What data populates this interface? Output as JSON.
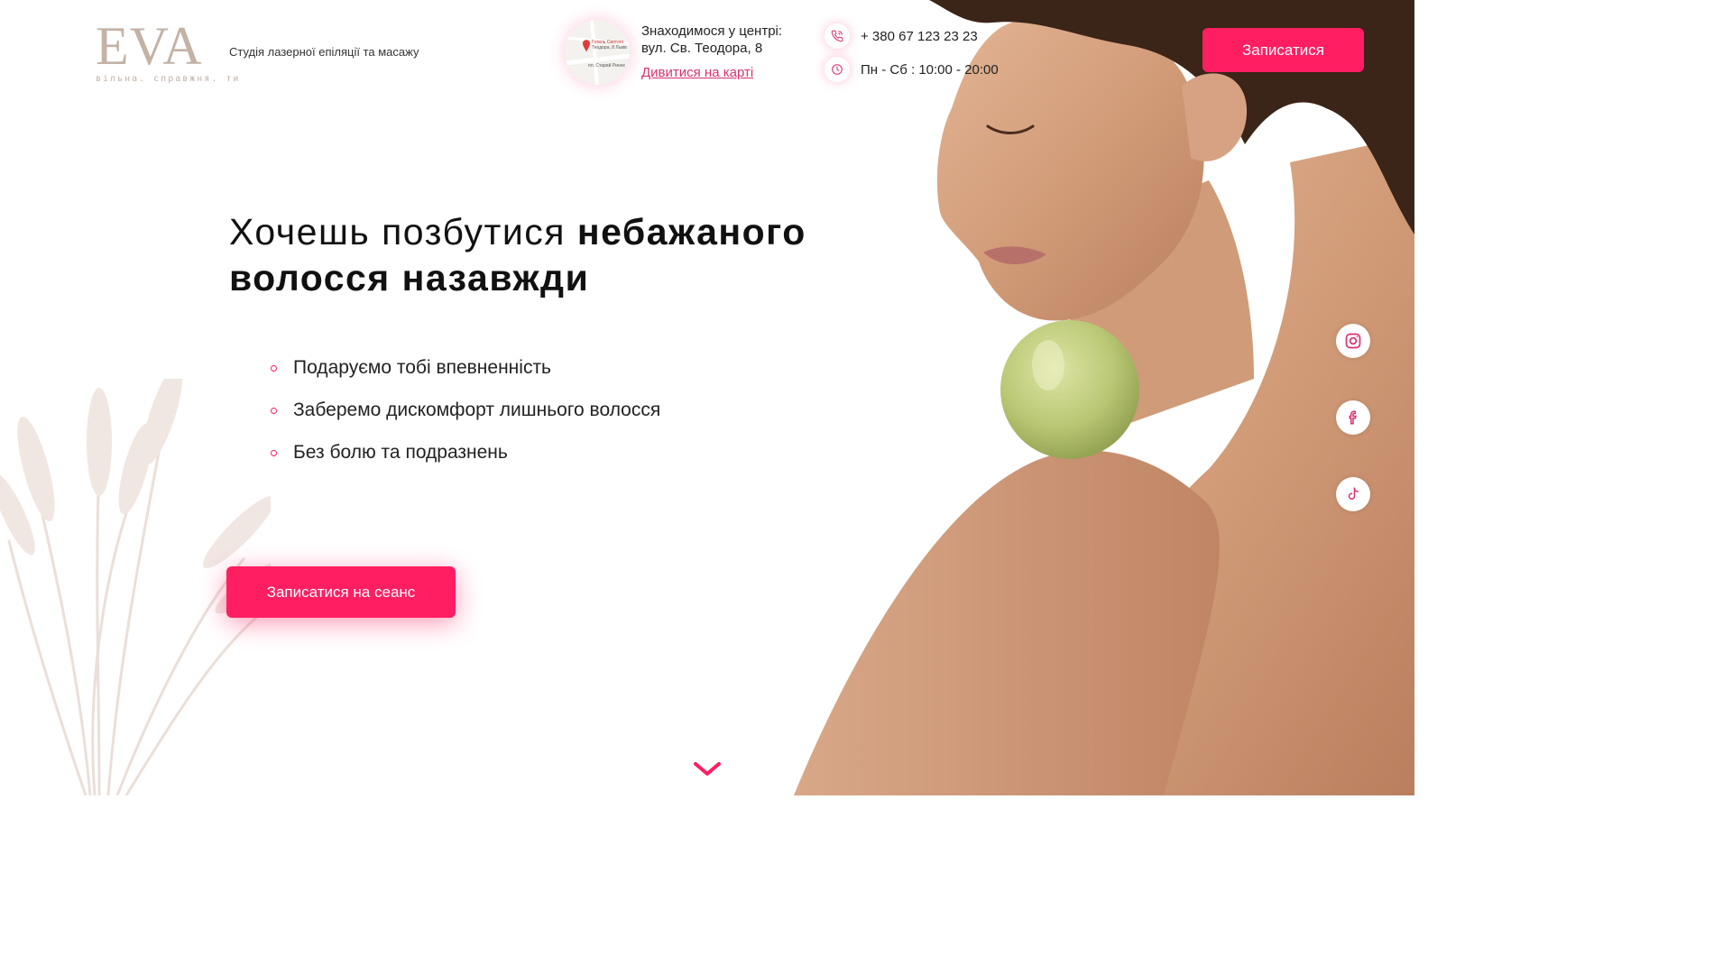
{
  "header": {
    "logo_text": "EVA",
    "logo_tagline": "вільна. справжня. ти",
    "studio_description": "Студія лазерної епіляції та масажу",
    "address_line1": "Знаходимося у центрі:",
    "address_line2": "вул. Св. Теодора, 8",
    "map_link": "Дивитися на карті",
    "phone": "+ 380 67 123 23 23",
    "hours": "Пн - Сб : 10:00 - 20:00",
    "book_button": "Записатися"
  },
  "map_thumbnail": {
    "labels": [
      "Готель Святого",
      "Теодора, 8 Львів",
      "пл. Старий Ринок"
    ]
  },
  "hero": {
    "title_regular": "Хочешь позбутися ",
    "title_bold": "небажаного волосся назавжди",
    "benefits": [
      "Подаруємо тобі впевненність",
      "Заберемо дискомфорт лишнього волосся",
      "Без болю та подразнень"
    ],
    "cta_button": "Записатися на сеанс"
  },
  "social": {
    "icons": [
      "instagram-icon",
      "facebook-icon",
      "tiktok-icon"
    ]
  },
  "colors": {
    "accent": "#ff1e62",
    "link": "#d9316f",
    "logo": "#c3b2a6",
    "text": "#111111"
  }
}
